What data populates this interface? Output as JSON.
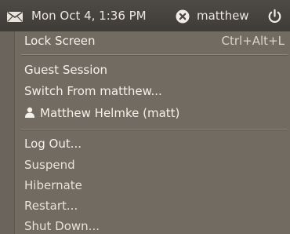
{
  "panel": {
    "mail_icon": "envelope-icon",
    "clock": "Mon Oct  4,  1:36 PM",
    "status_icon": "status-x-icon",
    "username": "matthew",
    "power_icon": "power-icon"
  },
  "menu": {
    "lock_screen": {
      "label": "Lock Screen",
      "shortcut": "Ctrl+Alt+L"
    },
    "guest_session": "Guest Session",
    "switch_from": "Switch From matthew...",
    "user_entry": {
      "icon": "person-icon",
      "label": "Matthew Helmke (matt)"
    },
    "log_out": "Log Out...",
    "suspend": "Suspend",
    "hibernate": "Hibernate",
    "restart": "Restart...",
    "shut_down": "Shut Down..."
  }
}
